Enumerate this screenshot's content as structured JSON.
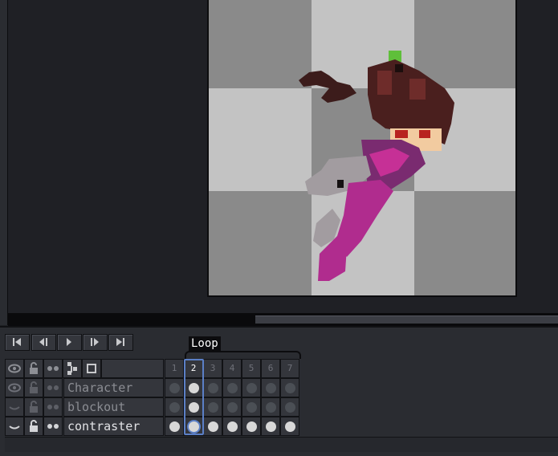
{
  "app": {
    "tag_name": "Loop",
    "playback": {
      "first": "first-frame-icon",
      "prev": "previous-frame-icon",
      "play": "play-icon",
      "next": "next-frame-icon",
      "last": "last-frame-icon"
    },
    "header_icons": [
      "eye-icon",
      "lock-icon",
      "continuous-icon",
      "link-cels-icon",
      "new-frame-icon"
    ],
    "frames": [
      "1",
      "2",
      "3",
      "4",
      "5",
      "6",
      "7"
    ],
    "active_frame": 2,
    "layers": [
      {
        "name": "Character",
        "visible": true,
        "locked": false,
        "continuous": false
      },
      {
        "name": "blockout",
        "visible": false,
        "locked": false,
        "continuous": false
      },
      {
        "name": "contraster",
        "visible": false,
        "locked": true,
        "continuous": true
      }
    ],
    "colors": {
      "background": "#1f2025",
      "panel": "#2a2c31",
      "cel_filled": "#d8d8d8",
      "cel_empty": "#4b4f55",
      "selection": "#5b7fc6"
    }
  }
}
